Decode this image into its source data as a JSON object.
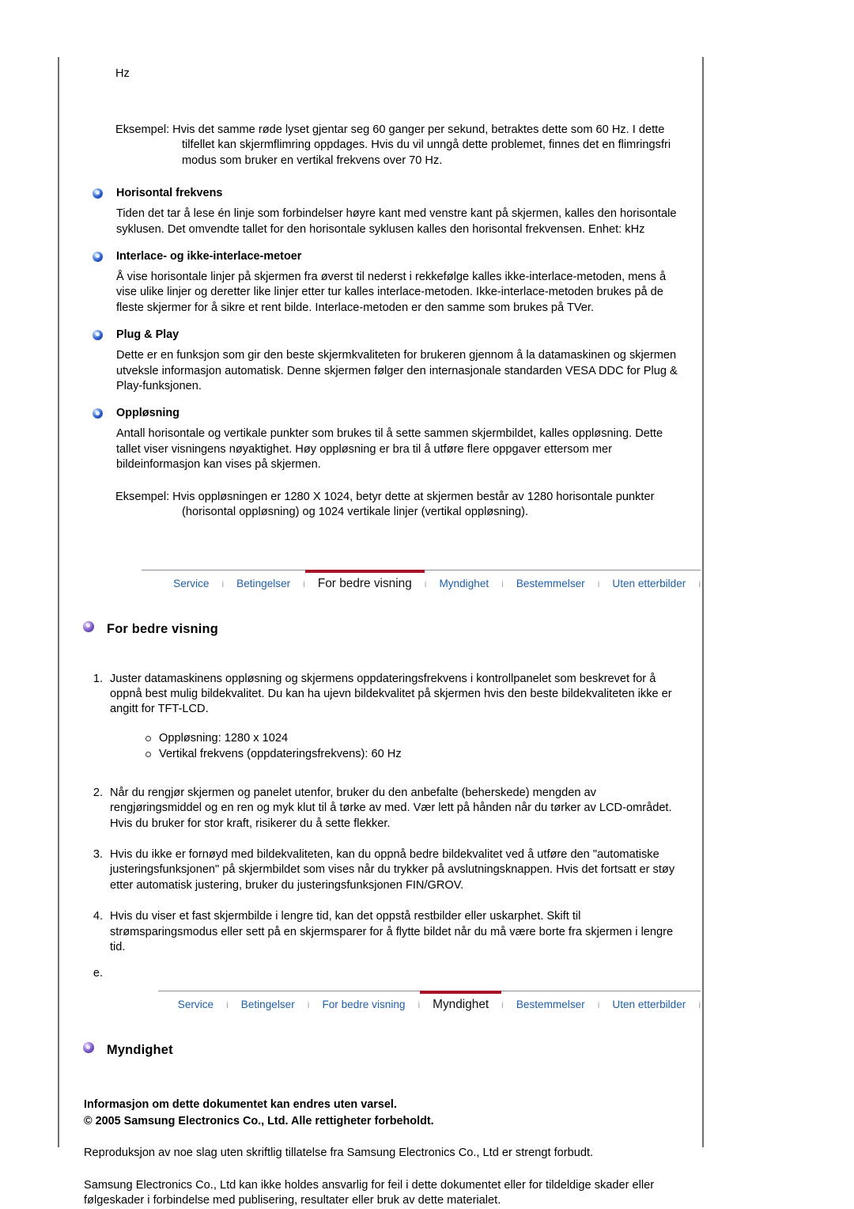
{
  "document": {
    "unit_line": "Hz",
    "example_vertical": "Eksempel: Hvis det samme røde lyset gjentar seg 60 ganger per sekund, betraktes dette som 60 Hz. I dette tilfellet kan skjermflimring oppdages. Hvis du vil unngå dette problemet, finnes det en flimringsfri modus som bruker en vertikal frekvens over 70 Hz.",
    "terms": [
      {
        "title": "Horisontal frekvens",
        "body": "Tiden det tar å lese én linje som forbindelser høyre kant med venstre kant på skjermen, kalles den horisontale syklusen. Det omvendte tallet for den horisontale syklusen kalles den horisontal frekvensen. Enhet: kHz"
      },
      {
        "title": "Interlace- og ikke-interlace-metoer",
        "body": "Å vise horisontale linjer på skjermen fra øverst til nederst i rekkefølge kalles ikke-interlace-metoden, mens å vise ulike linjer og deretter like linjer etter tur kalles interlace-metoden. Ikke-interlace-metoden brukes på de fleste skjermer for å sikre et rent bilde. Interlace-metoden er den samme som brukes på TVer."
      },
      {
        "title": "Plug & Play",
        "body": "Dette er en funksjon som gir den beste skjermkvaliteten for brukeren gjennom å la datamaskinen og skjermen utveksle informasjon automatisk. Denne skjermen følger den internasjonale standarden VESA DDC for Plug & Play-funksjonen."
      },
      {
        "title": "Oppløsning",
        "body": "Antall horisontale og vertikale punkter som brukes til å sette sammen skjermbildet, kalles oppløsning. Dette tallet viser visningens nøyaktighet. Høy oppløsning er bra til å utføre flere oppgaver ettersom mer bildeinformasjon kan vises på skjermen."
      }
    ],
    "example_resolution": "Eksempel: Hvis oppløsningen er 1280 X 1024, betyr dette at skjermen består av 1280 horisontale punkter (horisontal oppløsning) og 1024 vertikale linjer (vertikal oppløsning)."
  },
  "nav_primary": {
    "separator": "i",
    "active_index": 2,
    "tabs": [
      {
        "label": "Service"
      },
      {
        "label": "Betingelser"
      },
      {
        "label": "For bedre visning"
      },
      {
        "label": "Myndighet"
      },
      {
        "label": "Bestemmelser"
      },
      {
        "label": "Uten etterbilder"
      }
    ]
  },
  "nav_secondary": {
    "separator": "i",
    "active_index": 3,
    "tabs": [
      {
        "label": "Service"
      },
      {
        "label": "Betingelser"
      },
      {
        "label": "For bedre visning"
      },
      {
        "label": "Myndighet"
      },
      {
        "label": "Bestemmelser"
      },
      {
        "label": "Uten etterbilder"
      }
    ]
  },
  "section_better_view": {
    "heading": "For bedre visning",
    "steps": [
      {
        "num": "1.",
        "text": "Juster datamaskinens oppløsning og skjermens oppdateringsfrekvens i kontrollpanelet som beskrevet for å oppnå best mulig bildekvalitet. Du kan ha ujevn bildekvalitet på skjermen hvis den beste bildekvaliteten ikke er angitt for TFT-LCD.",
        "sub": [
          "Oppløsning: 1280 x 1024",
          "Vertikal frekvens (oppdateringsfrekvens): 60 Hz"
        ]
      },
      {
        "num": "2.",
        "text": "Når du rengjør skjermen og panelet utenfor, bruker du den anbefalte (beherskede) mengden av rengjøringsmiddel og en ren og myk klut til å tørke av med. Vær lett på hånden når du tørker av LCD-området. Hvis du bruker for stor kraft, risikerer du å sette flekker.",
        "sub": []
      },
      {
        "num": "3.",
        "text": "Hvis du ikke er fornøyd med bildekvaliteten, kan du oppnå bedre bildekvalitet ved å utføre den \"automatiske justeringsfunksjonen\" på skjermbildet som vises når du trykker på avslutningsknappen. Hvis det fortsatt er støy etter automatisk justering, bruker du justeringsfunksjonen FIN/GROV.",
        "sub": []
      },
      {
        "num": "4.",
        "text": "Hvis du viser et fast skjermbilde i lengre tid, kan det oppstå restbilder eller uskarphet. Skift til strømsparingsmodus eller sett på en skjermsparer for å flytte bildet når du må være borte fra skjermen i lengre tid.",
        "sub": []
      }
    ],
    "trailing_marker": "e."
  },
  "section_authority": {
    "heading": "Myndighet",
    "notice_line1": "Informasjon om dette dokumentet kan endres uten varsel.",
    "notice_line2": "© 2005 Samsung Electronics Co., Ltd. Alle rettigheter forbeholdt.",
    "paragraph1": "Reproduksjon av noe slag uten skriftlig tillatelse fra Samsung Electronics Co., Ltd er strengt forbudt.",
    "paragraph2": "Samsung Electronics Co., Ltd kan ikke holdes ansvarlig for feil i dette dokumentet eller for tildeldige skader eller følgeskader i forbindelse med publisering, resultater eller bruk av dette materialet."
  },
  "colors": {
    "link": "#1f5fa8",
    "active_underline": "#a61228",
    "rule": "#8a8f97",
    "page_border": "#6e6e6e",
    "bullet_blue": "#2b5fd0",
    "bullet_purple": "#7b58c6"
  }
}
